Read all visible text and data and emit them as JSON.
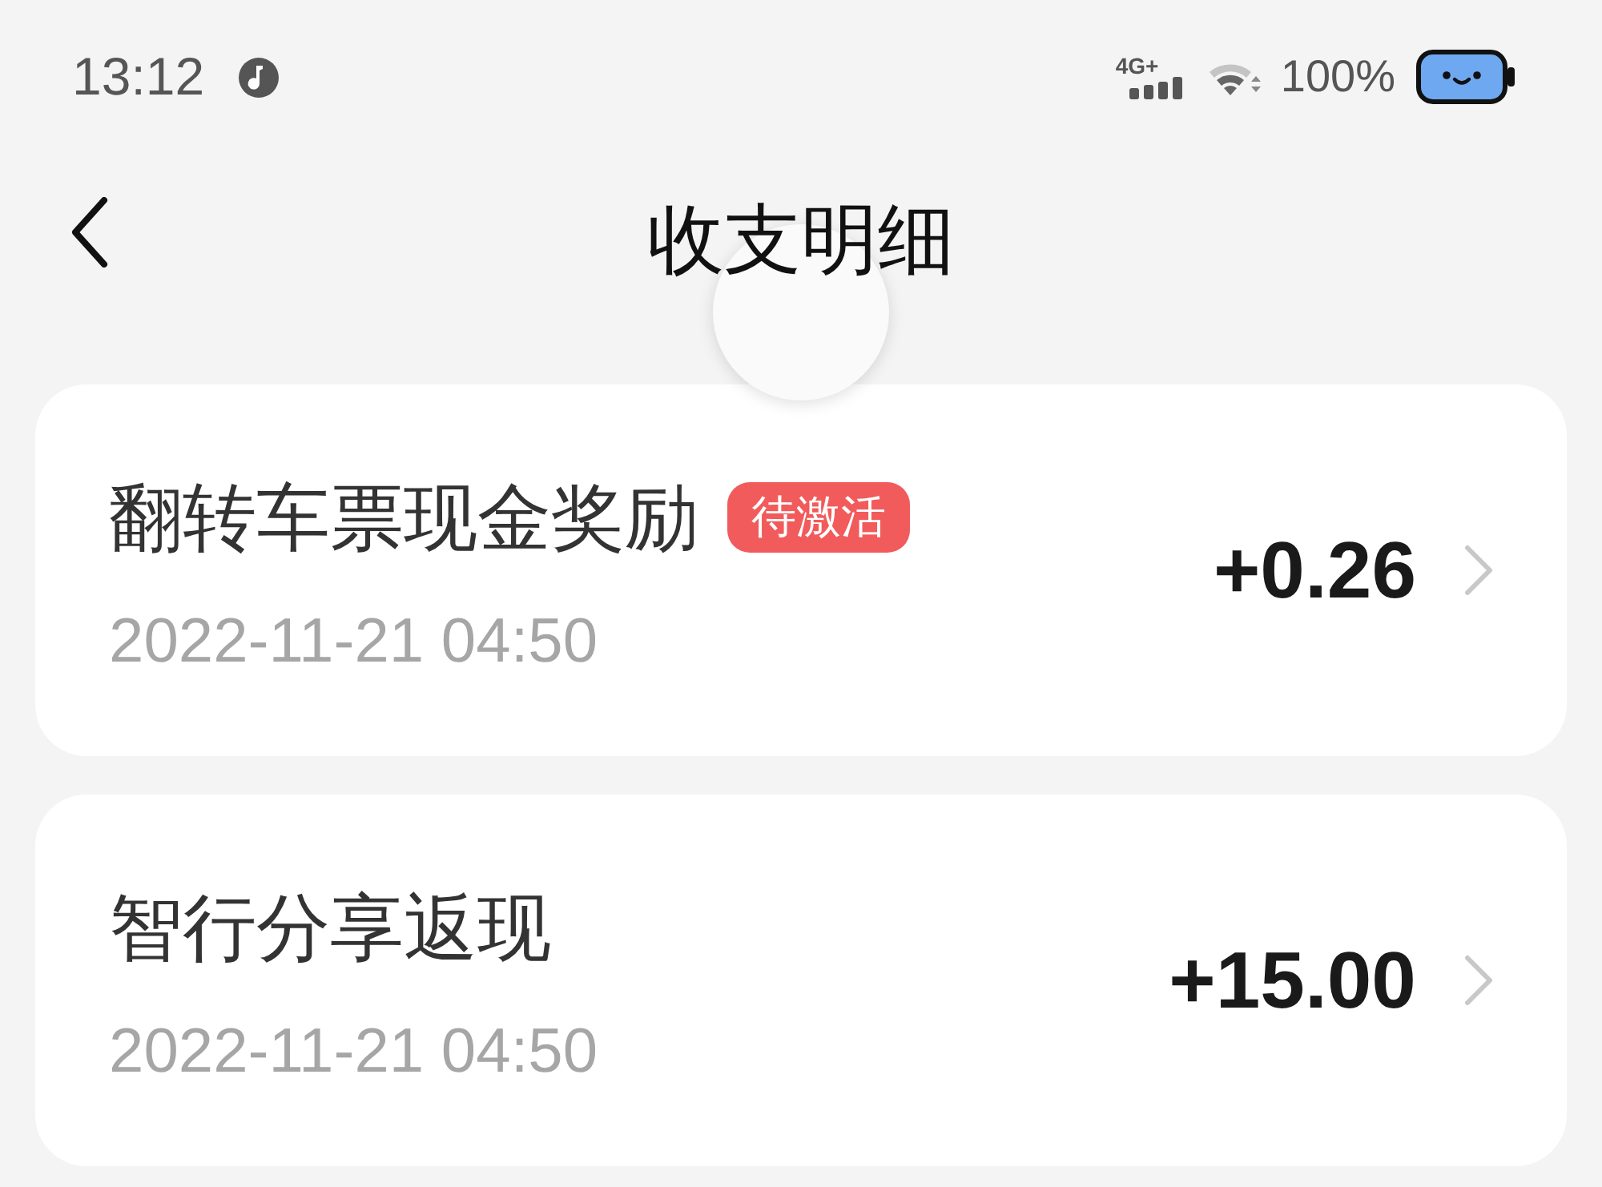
{
  "status_bar": {
    "time": "13:12",
    "network": "4G+",
    "battery": "100%"
  },
  "header": {
    "title": "收支明细"
  },
  "records": [
    {
      "title": "翻转车票现金奖励",
      "badge": "待激活",
      "date": "2022-11-21 04:50",
      "amount": "+0.26"
    },
    {
      "title": "智行分享返现",
      "date": "2022-11-21 04:50",
      "amount": "+15.00"
    }
  ]
}
